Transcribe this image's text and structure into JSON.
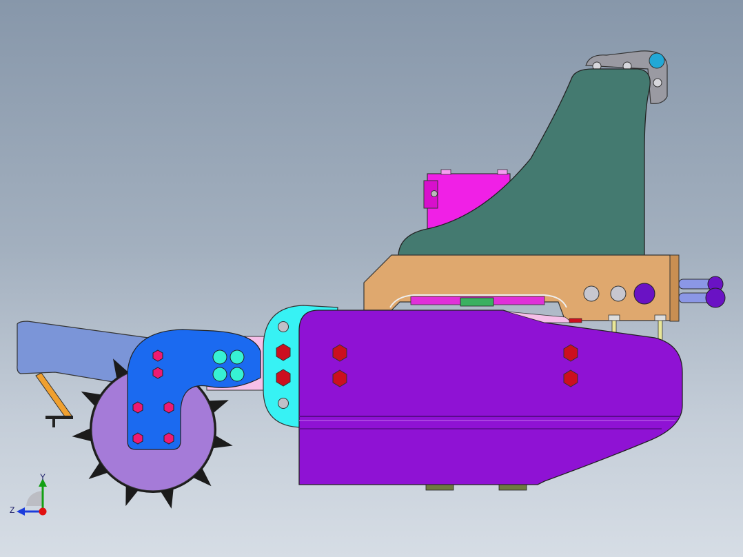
{
  "viewport": {
    "model": "seeder-assembly",
    "colors": {
      "background_top": "#8797aa",
      "background_bottom": "#d6dde5",
      "housing": "#8f12d4",
      "frame": "#dfa86e",
      "bracket": "#447a70",
      "gearbox": "#f020e6",
      "blue_arm": "#1b6af0",
      "handle": "#7b95d8",
      "coupler": "#37f2f4",
      "wheel": "#a57bd8",
      "bolt": "#cc0f1f"
    }
  },
  "triad": {
    "y_label": "Y",
    "z_label": "Z"
  }
}
